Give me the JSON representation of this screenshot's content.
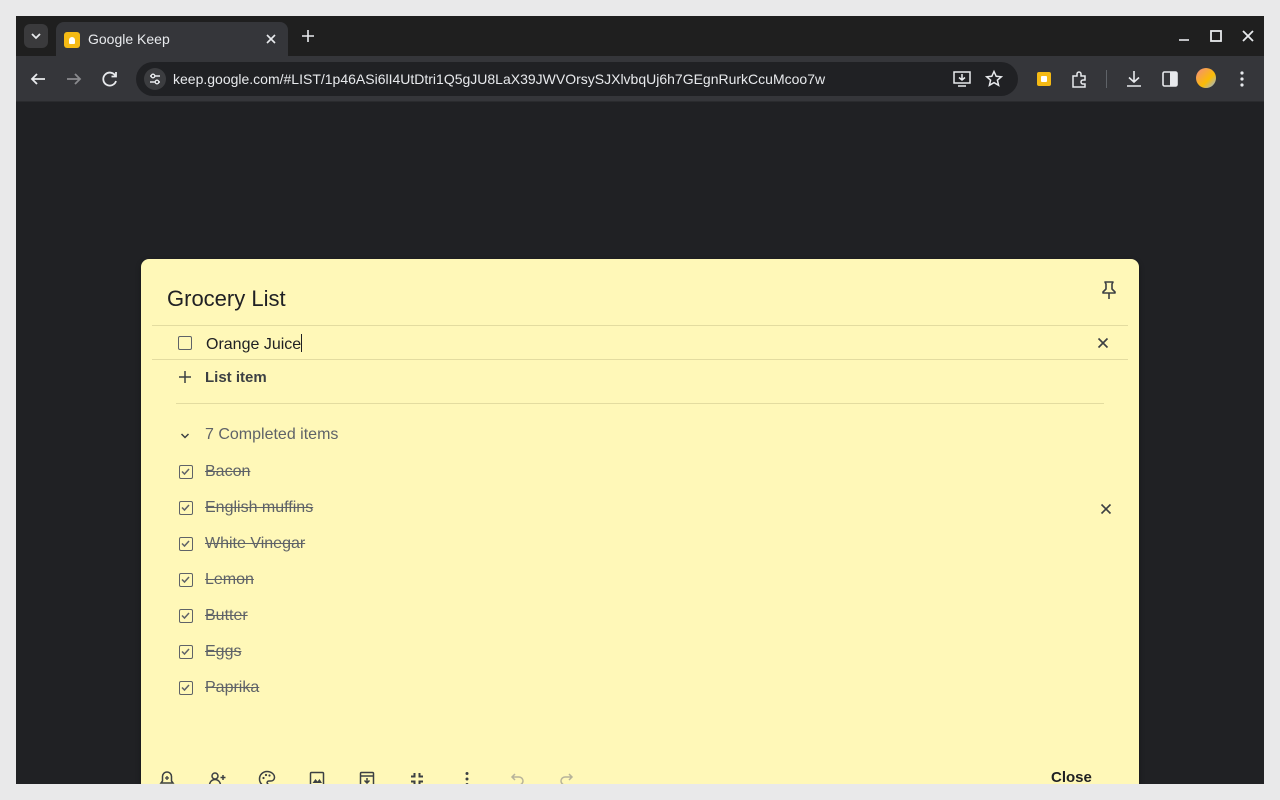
{
  "browser": {
    "tab_title": "Google Keep",
    "url": "keep.google.com/#LIST/1p46ASi6lI4UtDtri1Q5gJU8LaX39JWVOrsySJXlvbqUj6h7GEgnRurkCcuMcoo7w"
  },
  "note": {
    "title": "Grocery List",
    "active_item": "Orange Juice",
    "add_item_label": "List item",
    "completed_label": "7 Completed items",
    "completed_items": [
      "Bacon",
      "English muffins",
      "White Vinegar",
      "Lemon",
      "Butter",
      "Eggs",
      "Paprika"
    ],
    "close_label": "Close",
    "background_color": "#fff8b8"
  },
  "icons": {
    "footer": [
      "reminder-icon",
      "collaborator-icon",
      "palette-icon",
      "image-icon",
      "archive-icon",
      "collapse-icon",
      "more-icon",
      "undo-icon",
      "redo-icon"
    ]
  }
}
